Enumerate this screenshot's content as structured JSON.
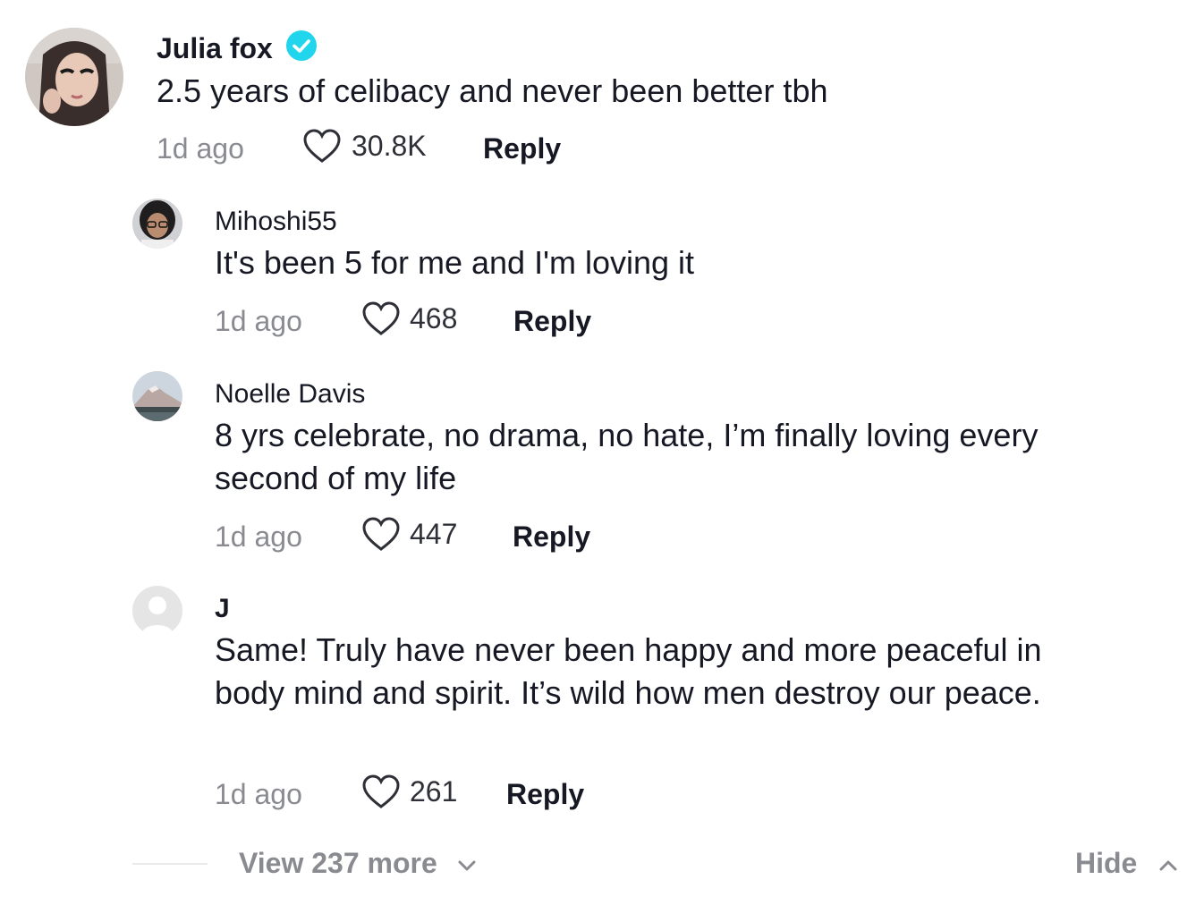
{
  "comment": {
    "username": "Julia fox",
    "verified": true,
    "text": "2.5 years of celibacy and never been better tbh",
    "time": "1d ago",
    "likes": "30.8K",
    "reply_label": "Reply"
  },
  "replies": [
    {
      "username": "Mihoshi55",
      "text": "It's been 5 for me and I'm loving it",
      "time": "1d ago",
      "likes": "468",
      "reply_label": "Reply"
    },
    {
      "username": "Noelle Davis",
      "text": "8 yrs celebrate, no drama, no hate, I’m finally loving every second of my life",
      "time": "1d ago",
      "likes": "447",
      "reply_label": "Reply"
    },
    {
      "username": "J",
      "text": "Same! Truly have never been happy and more peaceful in body mind and spirit. It’s wild how men destroy our peace.",
      "time": "1d ago",
      "likes": "261",
      "reply_label": "Reply"
    }
  ],
  "footer": {
    "view_more_label": "View 237 more",
    "hide_label": "Hide"
  },
  "colors": {
    "verified_badge": "#20d5ec",
    "muted_text": "#8a8b91",
    "primary_text": "#161823"
  },
  "icons": {
    "like": "heart-outline-icon",
    "verified": "verified-badge-icon",
    "expand": "chevron-down-icon",
    "collapse": "chevron-up-icon"
  }
}
